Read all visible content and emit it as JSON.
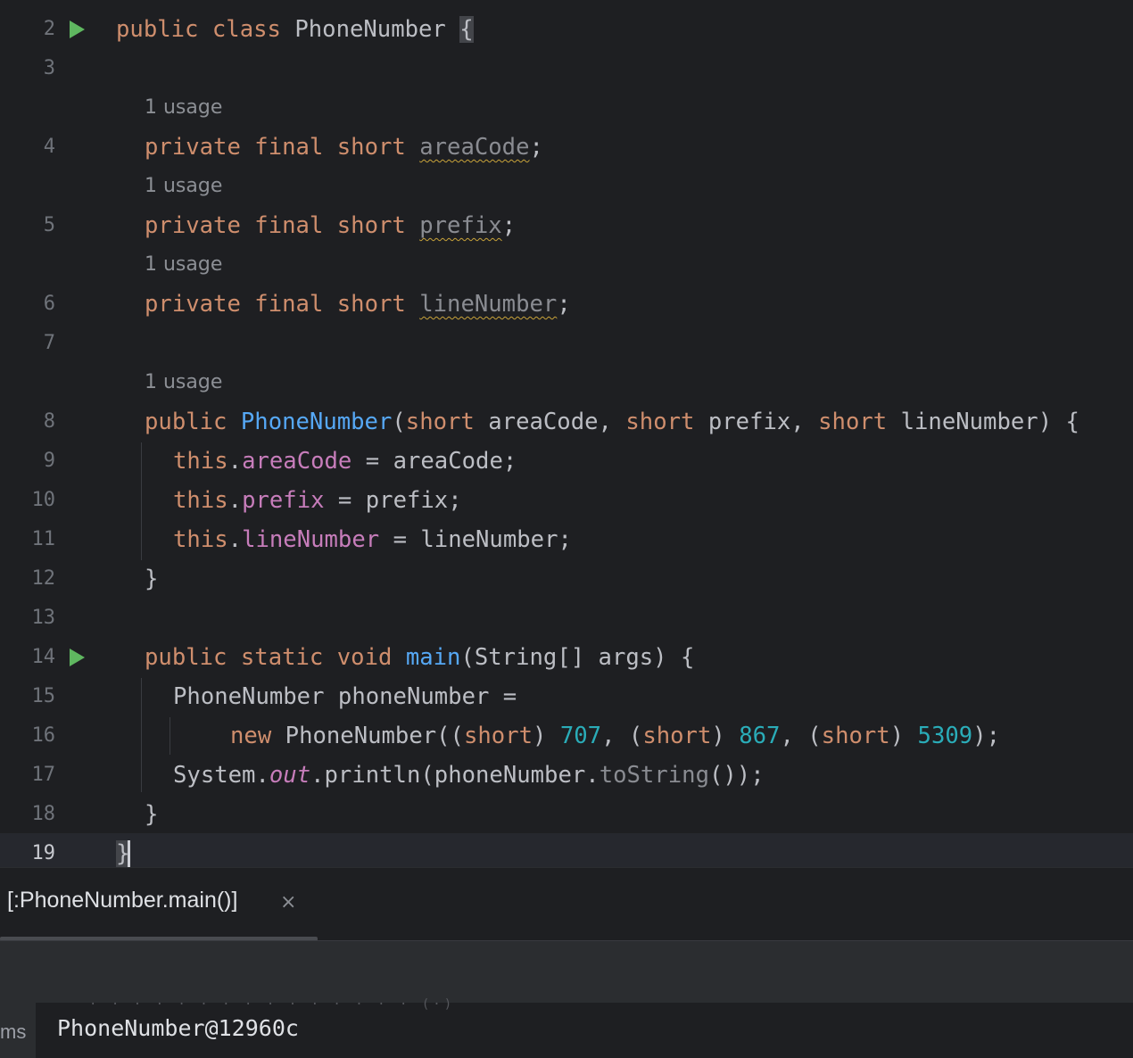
{
  "gutter": {
    "l2": "2",
    "l3": "3",
    "l4": "4",
    "l5": "5",
    "l6": "6",
    "l7": "7",
    "l8": "8",
    "l9": "9",
    "l10": "10",
    "l11": "11",
    "l12": "12",
    "l13": "13",
    "l14": "14",
    "l15": "15",
    "l16": "16",
    "l17": "17",
    "l18": "18",
    "l19": "19"
  },
  "hints": {
    "usage": "1 usage"
  },
  "code": {
    "public": "public",
    "class": "class",
    "private": "private",
    "final": "final",
    "short": "short",
    "static": "static",
    "void": "void",
    "new": "new",
    "this": "this",
    "class_name": "PhoneNumber",
    "open_brace": "{",
    "close_brace": "}",
    "field_area": "areaCode",
    "field_prefix": "prefix",
    "field_line": "lineNumber",
    "semicolon": ";",
    "ctor_name": "PhoneNumber",
    "p_area": "areaCode",
    "p_prefix": "prefix",
    "p_line": "lineNumber",
    "main_name": "main",
    "main_params": "(String[] args) {",
    "decl": "PhoneNumber phoneNumber =",
    "ctor_call": "PhoneNumber((",
    "n1": "707",
    "n2": "867",
    "n3": "5309",
    "system": "System.",
    "out": "out",
    "println": ".println(phoneNumber.",
    "to_string": "toString",
    "call_end": "());"
  },
  "run_tab": {
    "label": "[:PhoneNumber.main()]",
    "close": "×"
  },
  "console": {
    "gutter_label": "ms",
    "output": "PhoneNumber@12960c",
    "ghost": "· · · · · · · · · · · · · · · (·)"
  },
  "colors": {
    "background": "#1e1f22",
    "keyword": "#cf8e6d",
    "function": "#56a8f5",
    "field": "#c77dbb",
    "number": "#2aacb8",
    "run_icon": "#5fb760"
  }
}
